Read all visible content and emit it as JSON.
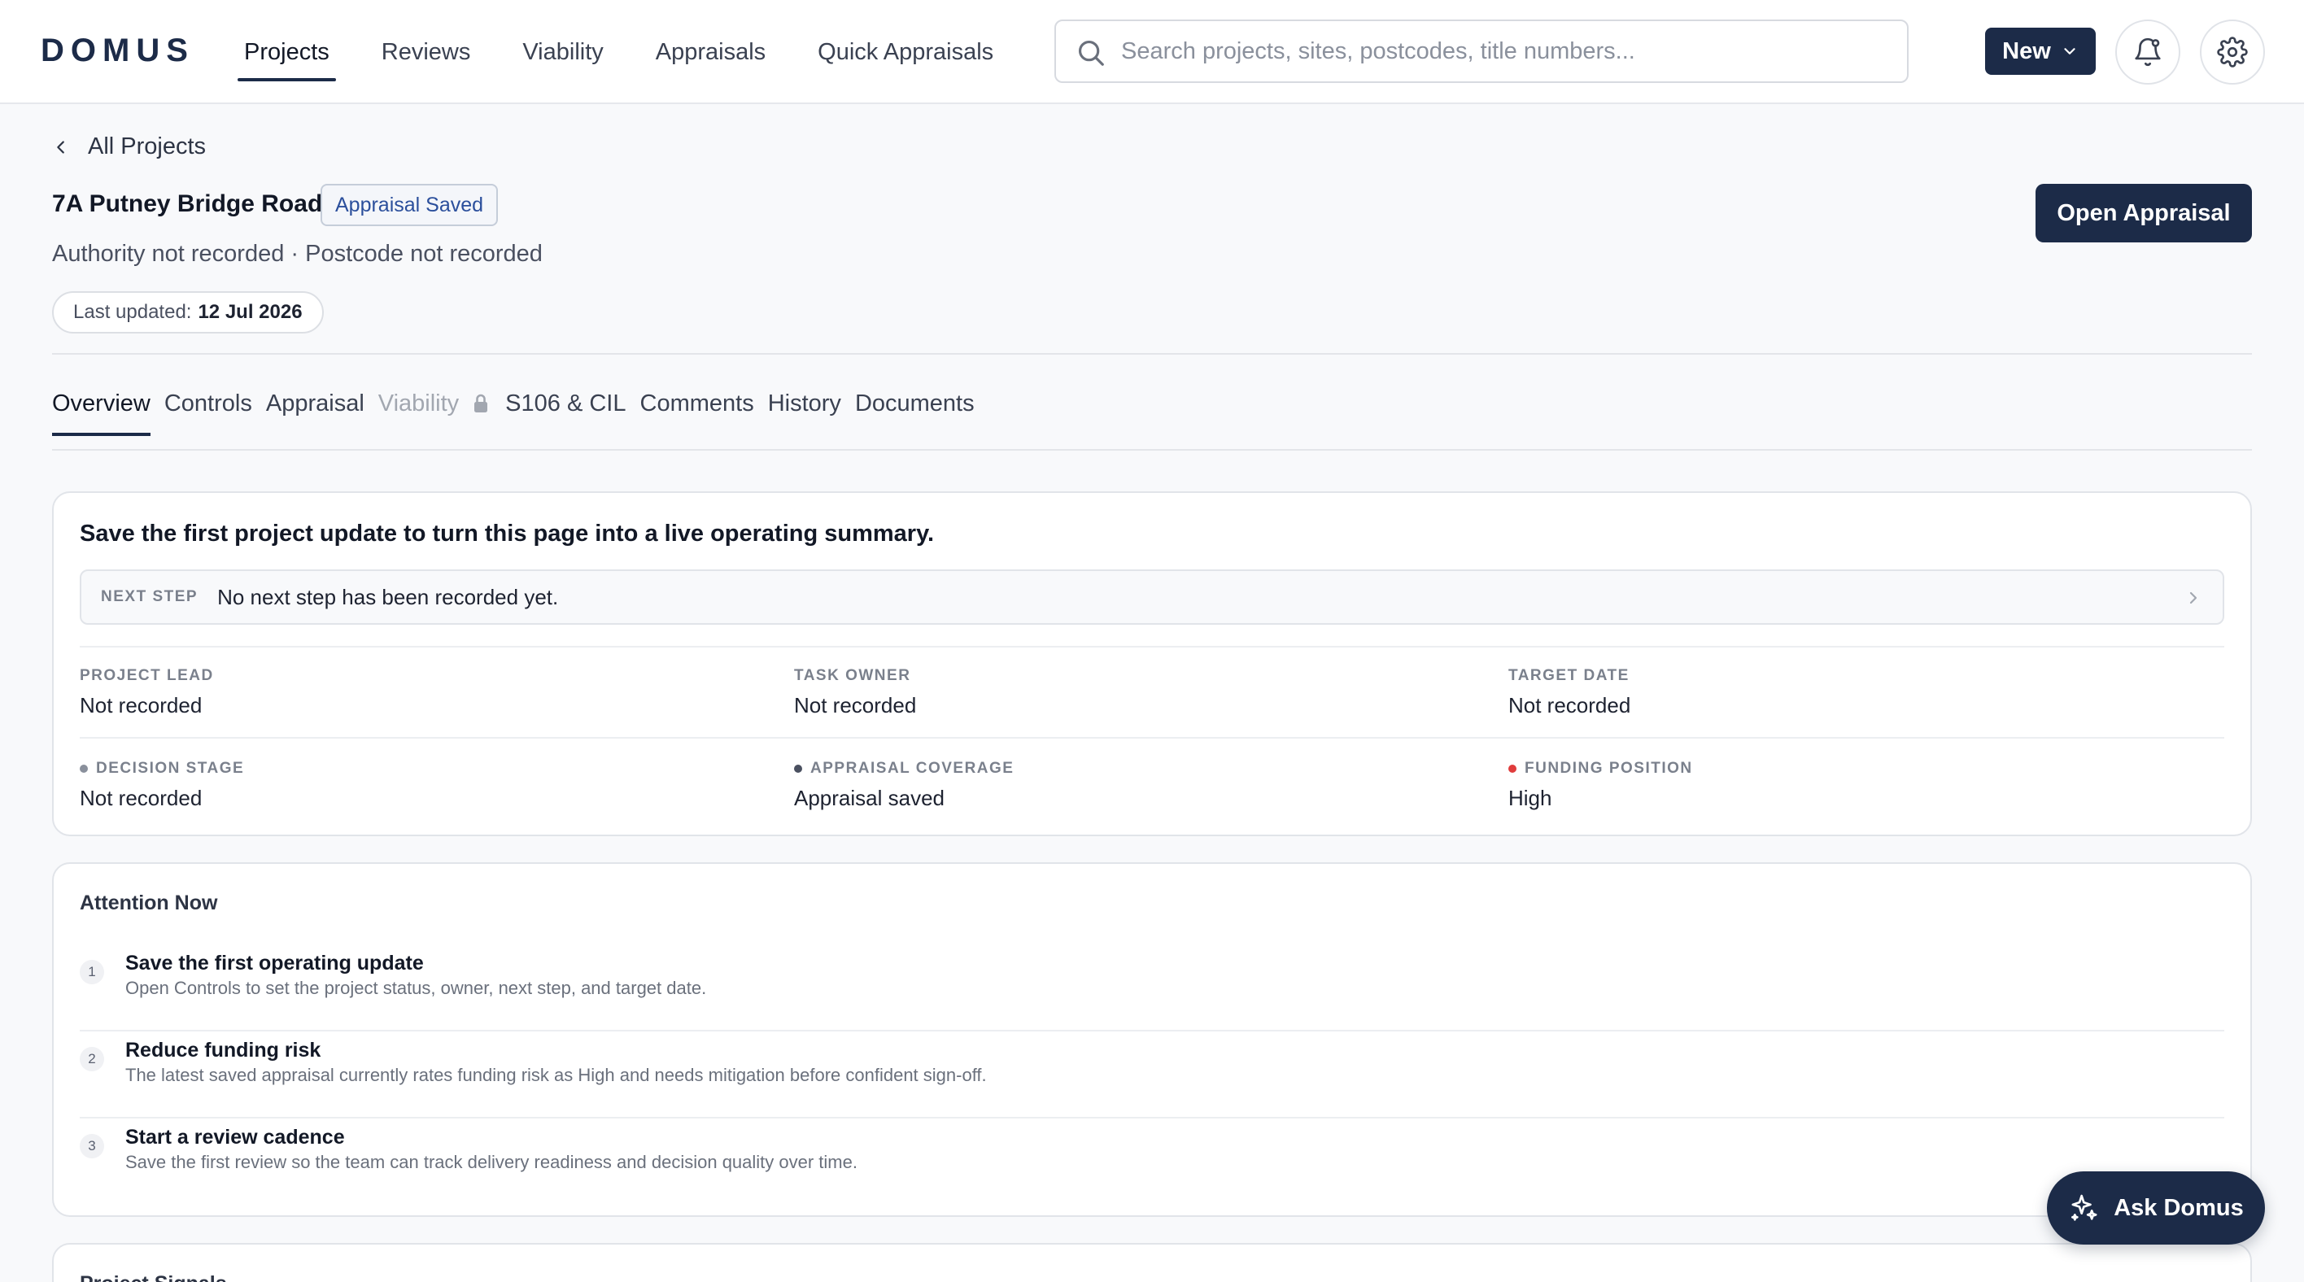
{
  "app": {
    "logo": "DOMUS"
  },
  "nav": {
    "items": [
      {
        "label": "Projects",
        "active": true
      },
      {
        "label": "Reviews",
        "active": false
      },
      {
        "label": "Viability",
        "active": false
      },
      {
        "label": "Appraisals",
        "active": false
      },
      {
        "label": "Quick Appraisals",
        "active": false
      }
    ]
  },
  "search": {
    "placeholder": "Search projects, sites, postcodes, title numbers...",
    "value": ""
  },
  "header_actions": {
    "new_label": "New",
    "icons": [
      "bell-icon",
      "gear-icon"
    ]
  },
  "breadcrumb": {
    "back_label": "All Projects"
  },
  "project": {
    "title": "7A Putney Bridge Road",
    "status_badge": "Appraisal Saved",
    "subline": "Authority not recorded · Postcode not recorded",
    "updated_label": "Last updated:",
    "updated_value": "12 Jul 2026",
    "open_button": "Open Appraisal"
  },
  "tabs": [
    {
      "label": "Overview",
      "state": "active"
    },
    {
      "label": "Controls",
      "state": "normal"
    },
    {
      "label": "Appraisal",
      "state": "normal"
    },
    {
      "label": "Viability",
      "state": "disabled",
      "locked": true
    },
    {
      "label": "S106 & CIL",
      "state": "normal"
    },
    {
      "label": "Comments",
      "state": "normal"
    },
    {
      "label": "History",
      "state": "normal"
    },
    {
      "label": "Documents",
      "state": "normal"
    }
  ],
  "summary": {
    "heading": "Save the first project update to turn this page into a live operating summary.",
    "next_step_label": "NEXT STEP",
    "next_step_value": "No next step has been recorded yet.",
    "fields": [
      {
        "label": "PROJECT LEAD",
        "value": "Not recorded"
      },
      {
        "label": "TASK OWNER",
        "value": "Not recorded"
      },
      {
        "label": "TARGET DATE",
        "value": "Not recorded"
      },
      {
        "label": "DECISION STAGE",
        "value": "Not recorded",
        "dot_color": "#8a909c"
      },
      {
        "label": "APPRAISAL COVERAGE",
        "value": "Appraisal saved",
        "dot_color": "#4a5060"
      },
      {
        "label": "FUNDING POSITION",
        "value": "High",
        "dot_color": "#e03c3c"
      }
    ]
  },
  "attention": {
    "title": "Attention Now",
    "items": [
      {
        "num": "1",
        "title": "Save the first operating update",
        "desc": "Open Controls to set the project status, owner, next step, and target date."
      },
      {
        "num": "2",
        "title": "Reduce funding risk",
        "desc": "The latest saved appraisal currently rates funding risk as High and needs mitigation before confident sign-off."
      },
      {
        "num": "3",
        "title": "Start a review cadence",
        "desc": "Save the first review so the team can track delivery readiness and decision quality over time."
      }
    ]
  },
  "signals": {
    "title": "Project Signals"
  },
  "fab": {
    "label": "Ask Domus"
  },
  "colors": {
    "brand": "#1c2b48",
    "danger": "#e03c3c",
    "badge_text": "#2b4f9c"
  }
}
